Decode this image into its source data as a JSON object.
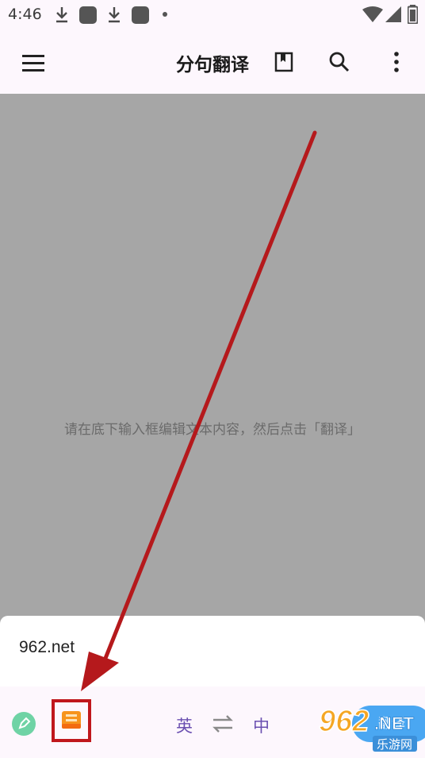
{
  "status_bar": {
    "time": "4:46",
    "icons": [
      "download-icon",
      "app-notification-icon",
      "download-icon",
      "app-notification-icon",
      "dot-icon",
      "wifi-icon",
      "signal-icon",
      "battery-icon"
    ]
  },
  "app_bar": {
    "title": "分句翻译",
    "icons": [
      "menu-icon",
      "book-icon",
      "search-icon",
      "more-vert-icon"
    ]
  },
  "content": {
    "hint": "请在底下输入框编辑文本内容，然后点击「翻译」"
  },
  "input": {
    "value": "962.net"
  },
  "bottom_bar": {
    "source_lang": "英",
    "target_lang": "中",
    "translate_label": "翻译",
    "accent_color": "#6a4fb0",
    "button_color": "#4aa7f2"
  },
  "annotation": {
    "arrow_color": "#b5191c",
    "highlight_color": "#c0171c"
  },
  "watermark": {
    "brand": "962",
    "suffix": ".NET",
    "subtitle": "乐游网"
  }
}
